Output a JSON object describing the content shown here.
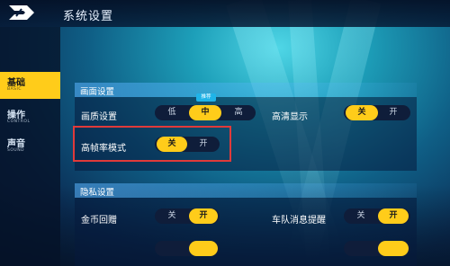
{
  "header": {
    "title": "系统设置",
    "logo_icon": "game-logo-icon"
  },
  "sidebar": {
    "items": [
      {
        "label": "基础",
        "sub": "BASIC",
        "active": true
      },
      {
        "label": "操作",
        "sub": "CONTROL",
        "active": false
      },
      {
        "label": "声音",
        "sub": "SOUND",
        "active": false
      }
    ]
  },
  "sections": {
    "graphics": {
      "title": "画面设置",
      "quality": {
        "label": "画质设置",
        "options": [
          "低",
          "中",
          "高"
        ],
        "selected": "中",
        "badge": "推荐"
      },
      "hd": {
        "label": "高清显示",
        "options": [
          "关",
          "开"
        ],
        "selected": "关"
      },
      "high_fps": {
        "label": "高帧率模式",
        "options": [
          "关",
          "开"
        ],
        "selected": "关"
      }
    },
    "privacy": {
      "title": "隐私设置",
      "coin_gift": {
        "label": "金币回赠",
        "options": [
          "关",
          "开"
        ],
        "selected": "开"
      },
      "team_msg": {
        "label": "车队消息提醒",
        "options": [
          "关",
          "开"
        ],
        "selected": "开"
      }
    }
  },
  "colors": {
    "accent": "#ffcc1a",
    "highlight_box": "#e03a3a",
    "badge": "#1fb4e8"
  }
}
